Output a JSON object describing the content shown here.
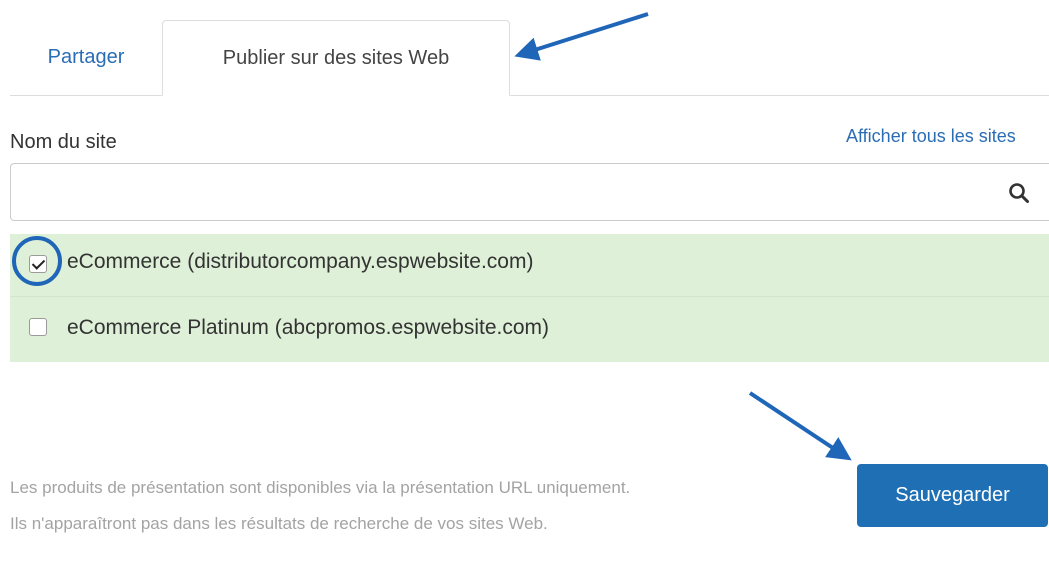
{
  "tabs": [
    {
      "label": "Partager",
      "active": false
    },
    {
      "label": "Publier sur des sites Web",
      "active": true
    }
  ],
  "form": {
    "site_name_label": "Nom du site",
    "show_all_link": "Afficher tous les sites",
    "search_value": "",
    "search_icon": "search-icon"
  },
  "sites": [
    {
      "label": "eCommerce (distributorcompany.espwebsite.com)",
      "checked": true
    },
    {
      "label": "eCommerce Platinum (abcpromos.espwebsite.com)",
      "checked": false
    }
  ],
  "info": {
    "line1": "Les produits de présentation sont disponibles via la présentation URL uniquement.",
    "line2": "Ils n'apparaîtront pas dans les résultats de recherche de vos sites Web."
  },
  "actions": {
    "save_label": "Sauvegarder"
  },
  "colors": {
    "accent": "#1f6fb5",
    "link": "#2a6db5",
    "selected_row_bg": "#dff0d8",
    "annotation": "#1f66b8"
  }
}
